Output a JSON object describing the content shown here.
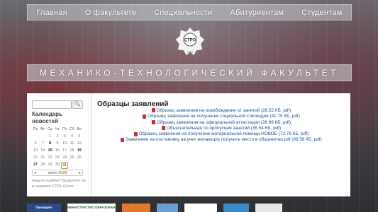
{
  "nav": {
    "items": [
      "Главная",
      "О факультете",
      "Специальности",
      "Абитуриентам",
      "Студентам"
    ]
  },
  "logo": {
    "text": "СТРО",
    "sub": "ГТИ"
  },
  "banner": {
    "title": "МЕХАНИКО-ТЕХНОЛОГИЧЕСКИЙ ФАКУЛЬТЕТ"
  },
  "sidebar": {
    "search_placeholder": "",
    "search_button": "🔍",
    "calendar_title": "Календарь новостей",
    "weekdays": [
      "Пн",
      "Вт",
      "Ср",
      "Чт",
      "Пт",
      "Сб",
      "Вс"
    ],
    "weeks": [
      [
        "",
        "",
        "1",
        "2",
        "3",
        "4",
        "5"
      ],
      [
        "6",
        "7",
        "8",
        "9",
        "10",
        "11",
        "12"
      ],
      [
        "13",
        "14",
        "15",
        "16",
        "17",
        "18",
        "19"
      ],
      [
        "20",
        "21",
        "22",
        "23",
        "24",
        "25",
        "26"
      ],
      [
        "27",
        "28",
        "29",
        "30",
        "31",
        "",
        ""
      ]
    ],
    "bold_days": [
      "8",
      "15",
      "19",
      "27"
    ],
    "today": "31",
    "month_label": "июля 2026",
    "prev": "◂",
    "next": "▸",
    "note": "Нашли ошибку? Выделите ее и нажмите CTRL+Enter"
  },
  "main": {
    "title": "Образцы заявлений",
    "files": [
      "Образец заявления на освобождение от занятий (26.52 КБ, pdf)",
      "Образец заявления на получение социальной стипендии (41.75 КБ, pdf)",
      "Образец заявления на официальной аттестации (26.99 КБ, pdf)",
      "Объяснительная по пропускам занятий (36.54 КБ, pdf)",
      "Образец заявления на получение материальной помощи НОВОЕ (72.78 КБ, pdf)",
      "Заявление на постановку на учет желающих получить место в общежитии.pdf (68.58 КБ, pdf)"
    ]
  },
  "footer": {
    "logos": [
      "Президент",
      "МИНИСТЕРСТВО ОБРАЗОВАНИЯ",
      "",
      "",
      "",
      "",
      ""
    ]
  }
}
